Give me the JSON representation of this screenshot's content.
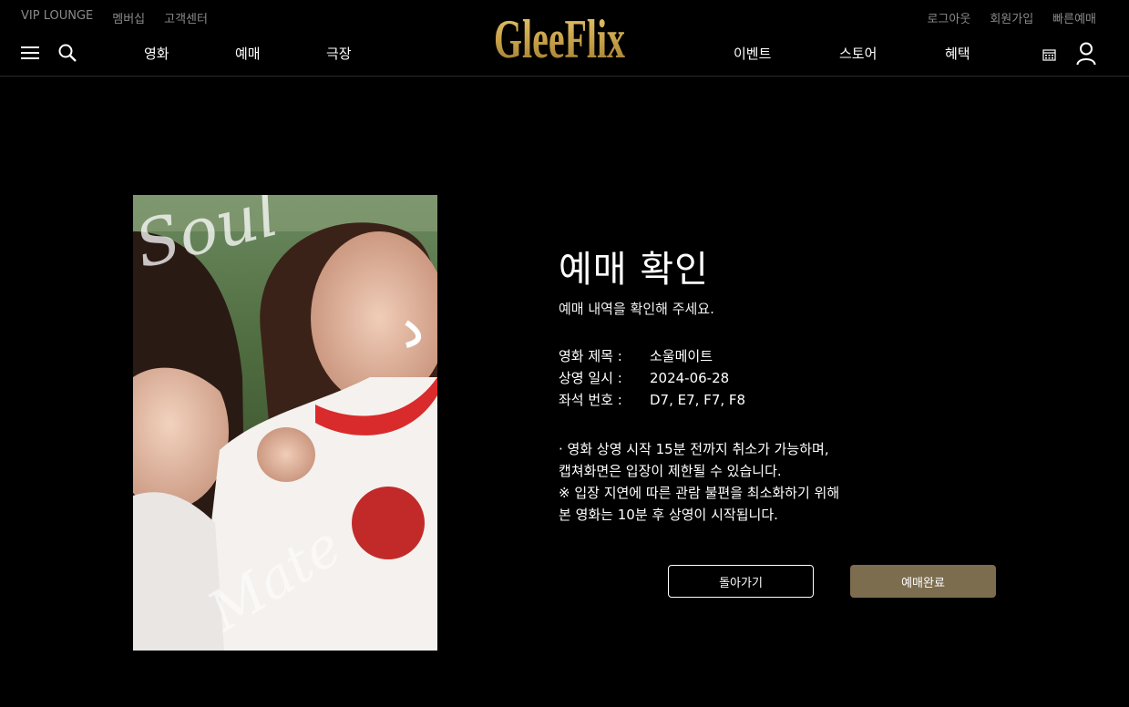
{
  "util_left": [
    "VIP LOUNGE",
    "멤버십",
    "고객센터"
  ],
  "util_right": [
    "로그아웃",
    "회원가입",
    "빠른예매"
  ],
  "brand": {
    "logo": "GleeFlix",
    "color": "#c9a24a"
  },
  "nav_left": [
    "영화",
    "예매",
    "극장"
  ],
  "nav_right": [
    "이벤트",
    "스토어",
    "혜택"
  ],
  "icons": {
    "menu": "hamburger-menu-icon",
    "search": "search-icon",
    "calendar": "calendar-icon",
    "user": "user-icon"
  },
  "poster": {
    "text_overlay_1": "Soul",
    "text_overlay_2": "Mate"
  },
  "confirm": {
    "title": "예매 확인",
    "subtitle": "예매 내역을 확인해 주세요.",
    "details": [
      {
        "key": "영화 제목 :",
        "value": "소울메이트"
      },
      {
        "key": "상영 일시 :",
        "value": "2024-06-28"
      },
      {
        "key": "좌석 번호 :",
        "value": "D7, E7, F7, F8"
      }
    ],
    "notice": [
      "· 영화 상영 시작 15분 전까지 취소가 가능하며,",
      "캡쳐화면은 입장이 제한될 수 있습니다.",
      "※ 입장 지연에 따른 관람 불편을 최소화하기 위해",
      "본 영화는 10분 후 상영이 시작됩니다."
    ]
  },
  "buttons": {
    "back": "돌아가기",
    "complete": "예매완료"
  },
  "colors": {
    "accent": "#7d6d4f",
    "background": "#000000"
  }
}
